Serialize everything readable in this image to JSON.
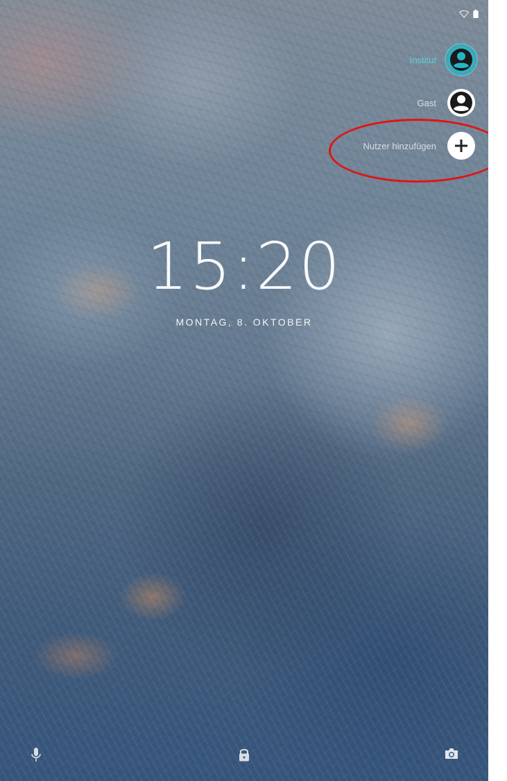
{
  "status_bar": {
    "icons": [
      "wifi-icon",
      "battery-icon"
    ]
  },
  "user_switcher": {
    "users": [
      {
        "label": "Institut",
        "icon": "account-circle-icon",
        "active": true
      },
      {
        "label": "Gast",
        "icon": "account-circle-icon",
        "active": false
      },
      {
        "label": "Nutzer hinzufügen",
        "icon": "add-icon",
        "active": false
      }
    ],
    "accent_color": "#3fc3d1",
    "highlight_color": "#e01414"
  },
  "clock": {
    "time": "15:20",
    "date": "MONTAG, 8. OKTOBER"
  },
  "bottom_bar": {
    "left_icon": "mic-icon",
    "center_icon": "lock-icon",
    "right_icon": "camera-icon"
  }
}
